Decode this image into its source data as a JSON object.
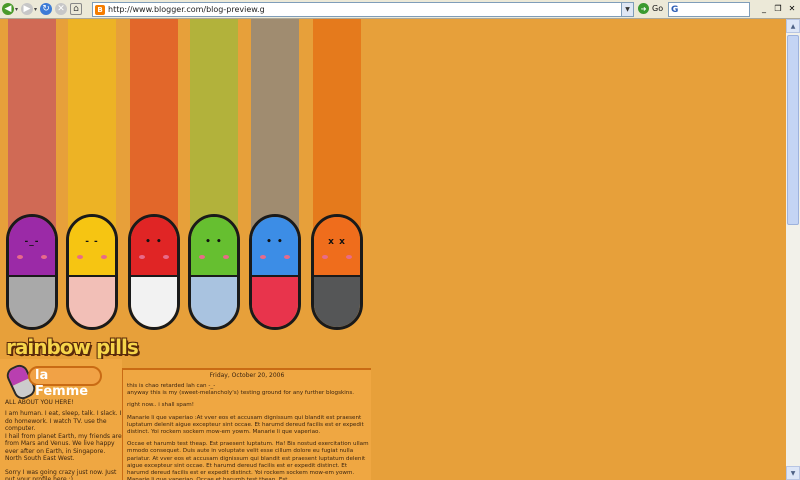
{
  "browser": {
    "address_url": "http://www.blogger.com/blog-preview.g",
    "go_label": "Go",
    "search_engine": "G"
  },
  "banner": {
    "pills": [
      {
        "stripe": "#d06a55",
        "top": "#9b2aa7",
        "bottom": "#a9a9a9",
        "face": "-_-"
      },
      {
        "stripe": "#edb325",
        "top": "#f6c512",
        "bottom": "#f2bfb7",
        "face": "- -"
      },
      {
        "stripe": "#e2672a",
        "top": "#e02525",
        "bottom": "#f2f2f2",
        "face": "• •"
      },
      {
        "stripe": "#b2b23b",
        "top": "#66bf30",
        "bottom": "#a9c3e0",
        "face": "• •"
      },
      {
        "stripe": "#a08c70",
        "top": "#3c8de6",
        "bottom": "#e8344c",
        "face": "• •"
      },
      {
        "stripe": "#e57a1c",
        "top": "#ef6d1c",
        "bottom": "#555657",
        "face": "x x"
      }
    ],
    "logo_text": "rainbow pills"
  },
  "sidebar": {
    "profile_name": "la Femme",
    "about_heading": "ALL ABOUT YOU HERE!",
    "about_lines": [
      "I am human. I eat, sleep, talk. I slack. I do homework. I watch TV. use the computer.",
      "I hail from planet Earth, my friends are from Mars and Venus. We live happy ever after on Earth, in Singapore.",
      "North South East West.",
      "Sorry I was going crazy just now. Just put your profile here :)"
    ]
  },
  "post": {
    "date": "Friday, October 20, 2006",
    "paragraphs": [
      "this is chao retarded lah can -_-\nanyway this is my (sweet-melancholy's) testing ground for any further blogskins.",
      "right now.. i shall spam!",
      "Manarie li que vaperiao :At vver eos et accusam dignissum qui blandit est praesent luptatum delenit aigue excepteur sint occae. Et harumd dereud facilis est er expedit distinct. Yoi rockem sockem mow-em yowm. Manarie li que vaperiao.",
      "Occae et harumb test theap. Est praesent luptatum. Ha! Bis nostud exercitation ullam mmodo consequet. Duis aute in voluptate velit esse cillum dolore eu fugiat nulla pariatur. At vver eos et accusam dignissum qui blandit est praesent luptatum delenit aigue excepteur sint occae. Et harumd dereud facilis est er expedit distinct. Et harumd dereud facilis est er expedit distinct. Yoi rockem sockem mow-em yowm. Manarie li que vaperiao. Occae et harumb test theap. Est"
    ]
  }
}
